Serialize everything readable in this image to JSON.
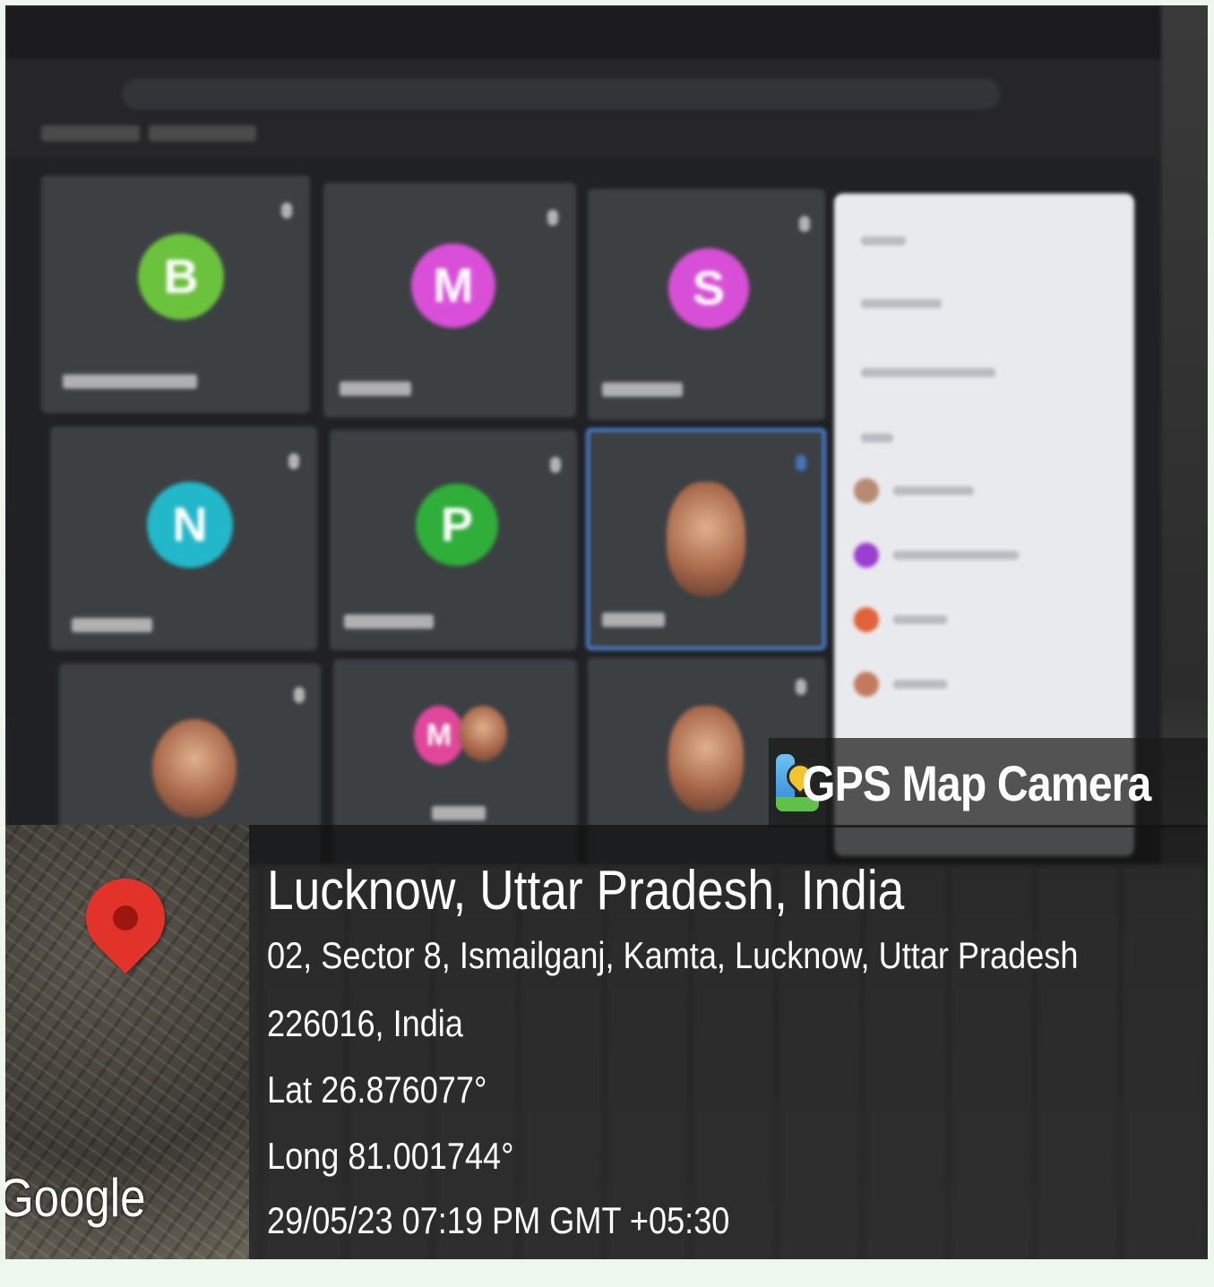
{
  "overlay": {
    "app_name": "GPS Map Camera",
    "location_title": "Lucknow, Uttar Pradesh, India",
    "address_line1": "02, Sector 8, Ismailganj, Kamta, Lucknow, Uttar Pradesh",
    "address_line2": "226016, India",
    "latitude": "Lat 26.876077°",
    "longitude": "Long 81.001744°",
    "datetime": "29/05/23 07:19 PM GMT +05:30",
    "map_attribution": "Google"
  },
  "meeting_tiles": [
    {
      "initial": "B",
      "color": "#6bc23d"
    },
    {
      "initial": "M",
      "color": "#d94fd8"
    },
    {
      "initial": "S",
      "color": "#d74fd6"
    },
    {
      "initial": "N",
      "color": "#22b7c9"
    },
    {
      "initial": "P",
      "color": "#2fae3a"
    },
    {
      "initial": "",
      "color": "#9b6b55"
    },
    {
      "initial": "",
      "color": "#b07a4e"
    },
    {
      "initial": "M",
      "color": "#e0479a"
    },
    {
      "initial": "",
      "color": "#c9886a"
    }
  ],
  "colors": {
    "highlight_tile": "#4a7fd6",
    "map_pin": "#e2332b",
    "people_panel": "#e9eaed"
  }
}
